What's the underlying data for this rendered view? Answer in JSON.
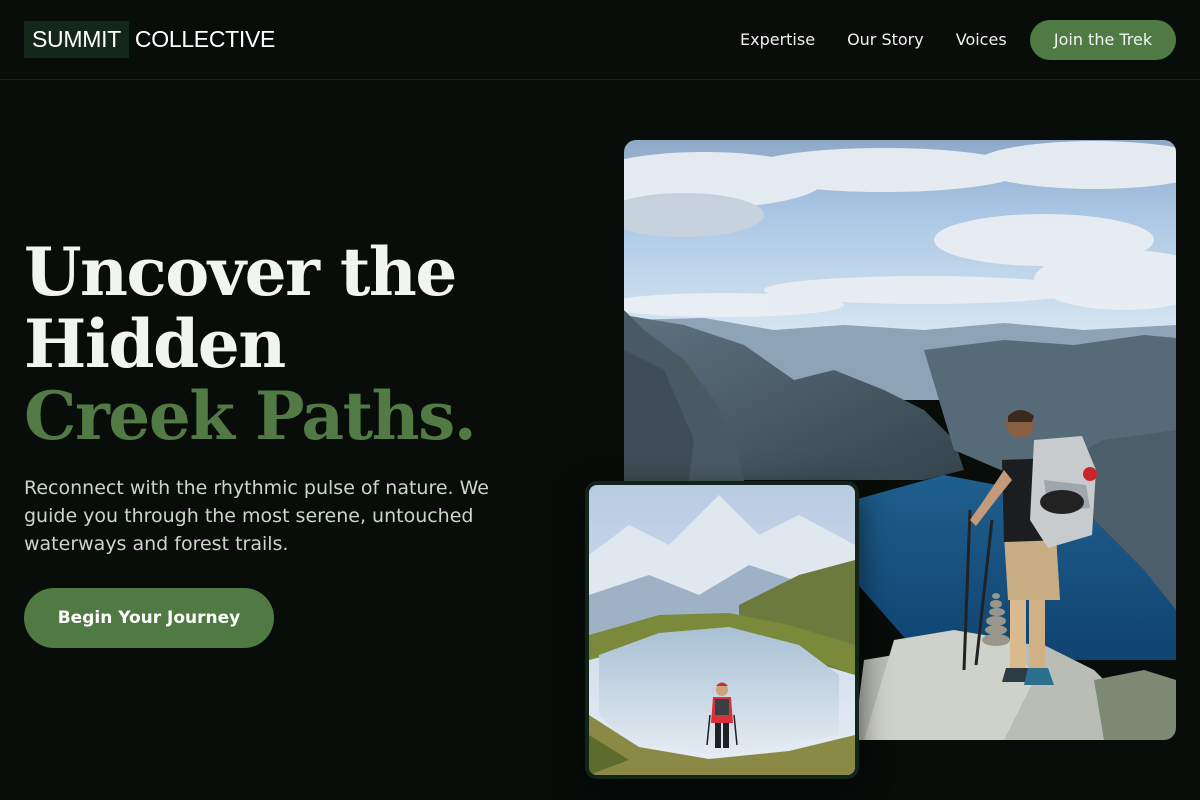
{
  "brand": {
    "box_text": "SUMMIT",
    "rest_text": "COLLECTIVE"
  },
  "nav": {
    "links": [
      "Expertise",
      "Our Story",
      "Voices"
    ],
    "cta": "Join the Trek"
  },
  "hero": {
    "headline_lines": [
      "Uncover the",
      "Hidden"
    ],
    "headline_accent": "Creek Paths.",
    "lead": "Reconnect with the rhythmic pulse of nature. We guide you through the most serene, untouched waterways and forest trails.",
    "cta": "Begin Your Journey"
  },
  "colors": {
    "background": "#080d0a",
    "accent": "#4f7a44",
    "headline_accent": "#527a45",
    "brand_box": "#13271b"
  },
  "images": {
    "main": {
      "subject": "hiker-with-trekking-poles-overlooking-fjord"
    },
    "small": {
      "subject": "hiker-standing-before-alpine-lake"
    }
  }
}
